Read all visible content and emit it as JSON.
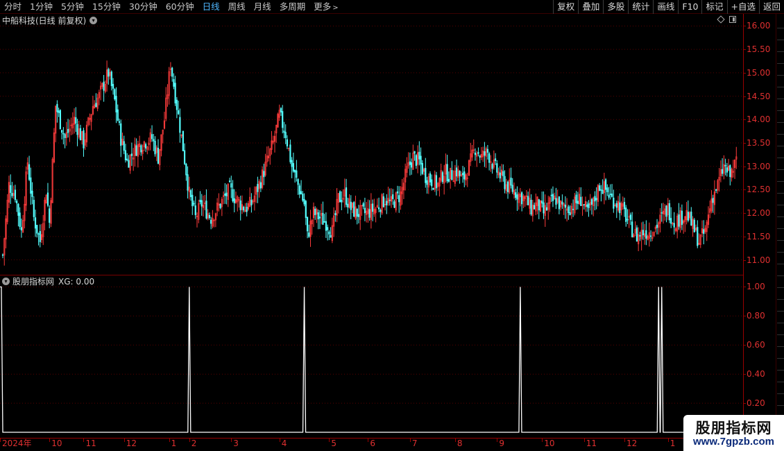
{
  "toolbar": {
    "periods": [
      {
        "label": "分时",
        "active": false
      },
      {
        "label": "1分钟",
        "active": false
      },
      {
        "label": "5分钟",
        "active": false
      },
      {
        "label": "15分钟",
        "active": false
      },
      {
        "label": "30分钟",
        "active": false
      },
      {
        "label": "60分钟",
        "active": false
      },
      {
        "label": "日线",
        "active": true
      },
      {
        "label": "周线",
        "active": false
      },
      {
        "label": "月线",
        "active": false
      },
      {
        "label": "多周期",
        "active": false
      },
      {
        "label": "更多",
        "active": false
      }
    ],
    "more_arrow": ">",
    "buttons": [
      "复权",
      "叠加",
      "多股",
      "统计",
      "画线",
      "F10",
      "标记",
      "+自选",
      "返回"
    ]
  },
  "main_chart": {
    "title": "中船科技(日线 前复权)",
    "y_labels": [
      "16.00",
      "15.50",
      "15.00",
      "14.50",
      "14.00",
      "13.50",
      "13.00",
      "12.50",
      "12.00",
      "11.50",
      "11.00"
    ]
  },
  "indicator": {
    "title": "股朋指标网",
    "value_text": "XG: 0.00",
    "y_labels": [
      "1.00",
      "0.80",
      "0.60",
      "0.40",
      "0.20"
    ]
  },
  "date_axis": [
    "2024年",
    "10",
    "11",
    "12",
    "1",
    "2",
    "3",
    "4",
    "5",
    "6",
    "7",
    "8",
    "9",
    "10",
    "11",
    "12",
    "1"
  ],
  "watermark": {
    "title": "股朋指标网",
    "url": "www.7gpzb.com"
  },
  "colors": {
    "up": "#ff3c3c",
    "down": "#54ffff",
    "axis": "#9a0000",
    "active_tab": "#4fb7ff"
  },
  "chart_data": [
    {
      "type": "candlestick",
      "title": "中船科技(日线 前复权)",
      "ylim": [
        10.8,
        16.2
      ],
      "x_ticks": [
        "2024年",
        "10",
        "11",
        "12",
        "1",
        "2",
        "3",
        "4",
        "5",
        "6",
        "7",
        "8",
        "9",
        "10",
        "11",
        "12",
        "1"
      ],
      "close_path": [
        [
          0,
          11.1
        ],
        [
          4,
          12.6
        ],
        [
          8,
          12.4
        ],
        [
          12,
          11.6
        ],
        [
          16,
          13.1
        ],
        [
          20,
          11.9
        ],
        [
          24,
          11.4
        ],
        [
          28,
          12.5
        ],
        [
          30,
          11.8
        ],
        [
          34,
          14.3
        ],
        [
          40,
          13.6
        ],
        [
          46,
          14.0
        ],
        [
          52,
          13.5
        ],
        [
          58,
          14.3
        ],
        [
          62,
          14.5
        ],
        [
          68,
          15.0
        ],
        [
          72,
          14.4
        ],
        [
          76,
          13.6
        ],
        [
          80,
          13.1
        ],
        [
          86,
          13.4
        ],
        [
          90,
          13.5
        ],
        [
          96,
          13.6
        ],
        [
          100,
          13.2
        ],
        [
          104,
          14.0
        ],
        [
          108,
          15.2
        ],
        [
          112,
          14.3
        ],
        [
          116,
          13.4
        ],
        [
          120,
          12.4
        ],
        [
          124,
          11.9
        ],
        [
          128,
          12.2
        ],
        [
          134,
          11.9
        ],
        [
          140,
          12.2
        ],
        [
          146,
          12.5
        ],
        [
          150,
          12.3
        ],
        [
          156,
          12.1
        ],
        [
          160,
          12.2
        ],
        [
          166,
          12.7
        ],
        [
          170,
          13.1
        ],
        [
          174,
          13.5
        ],
        [
          178,
          14.1
        ],
        [
          182,
          13.7
        ],
        [
          186,
          13.0
        ],
        [
          190,
          12.6
        ],
        [
          194,
          12.2
        ],
        [
          196,
          11.5
        ],
        [
          200,
          12.0
        ],
        [
          204,
          11.9
        ],
        [
          208,
          11.8
        ],
        [
          212,
          11.6
        ],
        [
          216,
          12.3
        ],
        [
          220,
          12.4
        ],
        [
          224,
          12.1
        ],
        [
          228,
          12.0
        ],
        [
          234,
          12.0
        ],
        [
          240,
          12.1
        ],
        [
          246,
          12.3
        ],
        [
          250,
          12.2
        ],
        [
          256,
          12.4
        ],
        [
          260,
          12.9
        ],
        [
          264,
          13.2
        ],
        [
          268,
          13.1
        ],
        [
          272,
          12.8
        ],
        [
          276,
          12.7
        ],
        [
          280,
          12.6
        ],
        [
          284,
          12.9
        ],
        [
          288,
          12.8
        ],
        [
          292,
          12.9
        ],
        [
          296,
          12.7
        ],
        [
          300,
          13.0
        ],
        [
          304,
          13.4
        ],
        [
          308,
          13.2
        ],
        [
          312,
          13.3
        ],
        [
          316,
          13.0
        ],
        [
          320,
          12.8
        ],
        [
          324,
          12.6
        ],
        [
          328,
          12.5
        ],
        [
          332,
          12.4
        ],
        [
          336,
          12.3
        ],
        [
          340,
          12.1
        ],
        [
          344,
          12.2
        ],
        [
          348,
          12.0
        ],
        [
          352,
          12.2
        ],
        [
          356,
          12.3
        ],
        [
          360,
          12.1
        ],
        [
          364,
          12.1
        ],
        [
          368,
          12.2
        ],
        [
          372,
          12.3
        ],
        [
          376,
          12.0
        ],
        [
          380,
          12.2
        ],
        [
          384,
          12.6
        ],
        [
          388,
          12.5
        ],
        [
          392,
          12.3
        ],
        [
          396,
          12.2
        ],
        [
          400,
          12.0
        ],
        [
          404,
          11.7
        ],
        [
          408,
          11.5
        ],
        [
          412,
          11.6
        ],
        [
          416,
          11.6
        ],
        [
          420,
          11.7
        ],
        [
          424,
          11.9
        ],
        [
          428,
          12.1
        ],
        [
          432,
          11.8
        ],
        [
          436,
          11.9
        ],
        [
          440,
          12.0
        ],
        [
          444,
          11.7
        ],
        [
          448,
          11.4
        ],
        [
          452,
          11.6
        ],
        [
          456,
          12.3
        ],
        [
          460,
          12.6
        ],
        [
          464,
          13.0
        ],
        [
          468,
          12.8
        ],
        [
          472,
          13.1
        ]
      ]
    },
    {
      "type": "line",
      "title": "股朋指标网",
      "ylim": [
        0,
        1.05
      ],
      "series": [
        {
          "name": "XG",
          "pulse_x": [
            0,
            120,
            194,
            333,
            422,
            424
          ]
        }
      ]
    }
  ]
}
